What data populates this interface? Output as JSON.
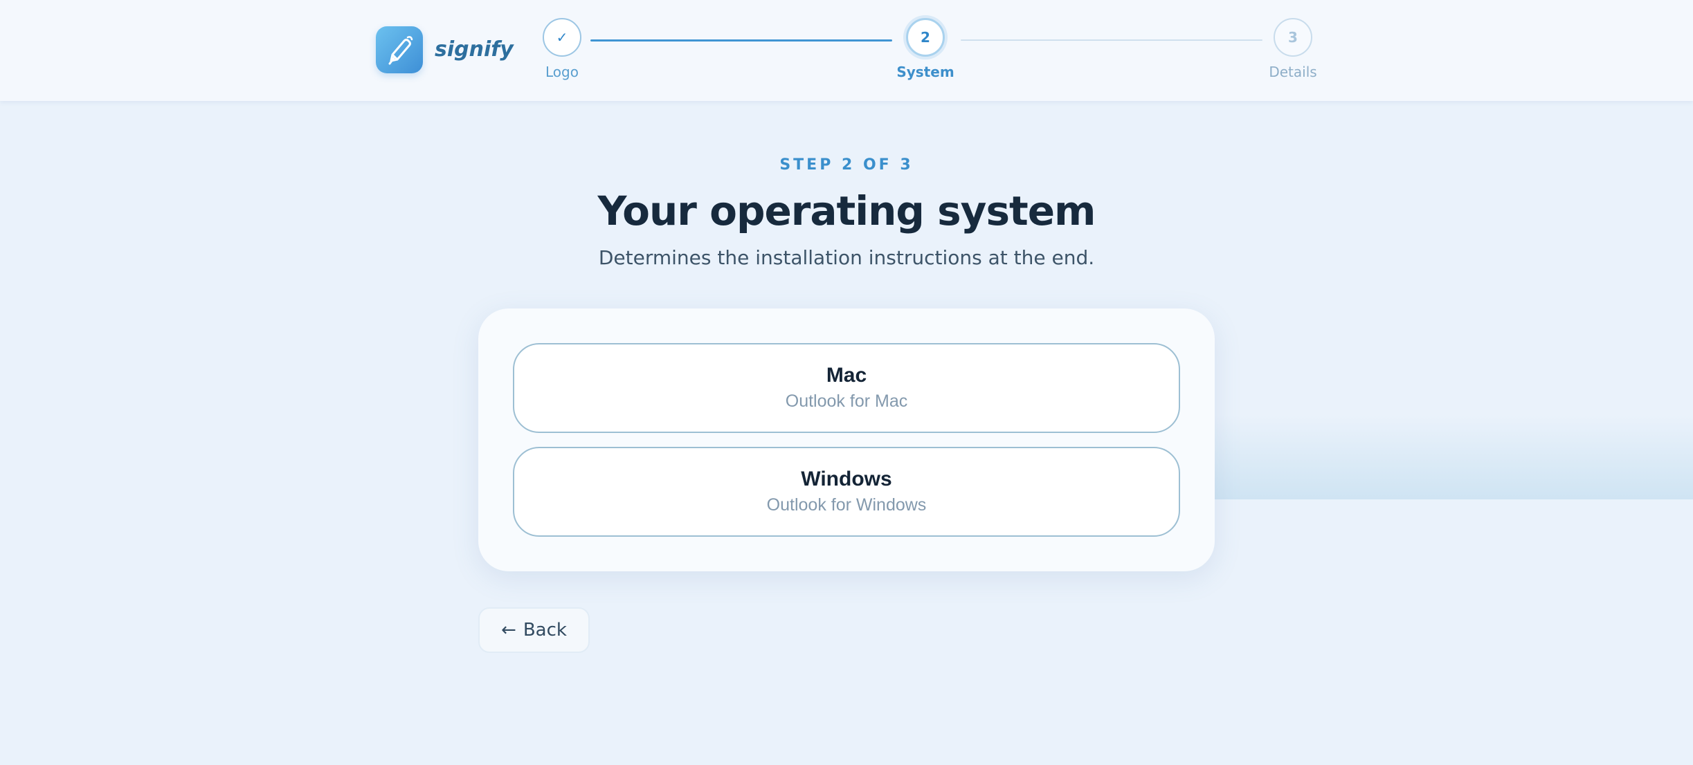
{
  "brand": {
    "name": "signify",
    "logo_icon": "pen-icon",
    "accent": "#3e8fd6"
  },
  "stepper": {
    "steps": [
      {
        "label": "Logo",
        "marker": "✓",
        "state": "completed"
      },
      {
        "label": "System",
        "marker": "2",
        "state": "current"
      },
      {
        "label": "Details",
        "marker": "3",
        "state": "upcoming"
      }
    ]
  },
  "main": {
    "eyebrow": "STEP 2 OF 3",
    "title": "Your operating system",
    "subtitle": "Determines the installation instructions at the end."
  },
  "options": [
    {
      "title": "Mac",
      "subtitle": "Outlook for Mac"
    },
    {
      "title": "Windows",
      "subtitle": "Outlook for Windows"
    }
  ],
  "back": {
    "arrow": "←",
    "label": "Back"
  }
}
